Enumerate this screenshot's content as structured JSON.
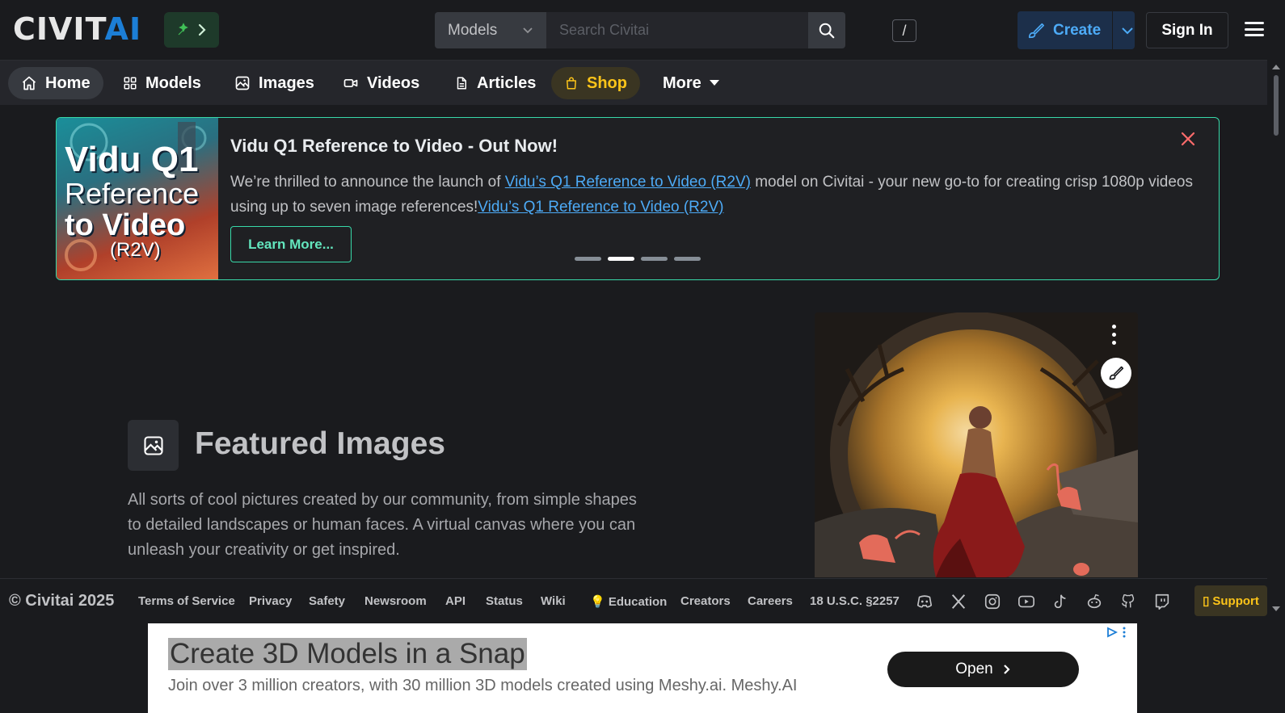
{
  "header": {
    "logo_main": "CIVIT",
    "logo_accent": "AI",
    "search_category": "Models",
    "search_placeholder": "Search Civitai",
    "search_shortcut": "/",
    "create_label": "Create",
    "signin_label": "Sign In"
  },
  "nav": {
    "items": [
      {
        "label": "Home",
        "icon": "home-icon"
      },
      {
        "label": "Models",
        "icon": "grid-icon"
      },
      {
        "label": "Images",
        "icon": "photo-icon"
      },
      {
        "label": "Videos",
        "icon": "video-icon"
      },
      {
        "label": "Articles",
        "icon": "file-text-icon"
      },
      {
        "label": "Shop",
        "icon": "shopping-bag-icon"
      },
      {
        "label": "More",
        "icon": "caret-down-icon"
      }
    ]
  },
  "announcement": {
    "thumb_line1": "Vidu Q1",
    "thumb_line2": "Reference",
    "thumb_line3": "to Video",
    "thumb_line4": "(R2V)",
    "title": "Vidu Q1 Reference to Video - Out Now!",
    "body_part1": "We’re thrilled to announce the launch of ",
    "link1": "Vidu’s Q1 Reference to Video (R2V)",
    "body_part2": " model on Civitai - your new go-to for creating crisp 1080p videos using up to seven image references!",
    "link2": "Vidu’s Q1 Reference to Video (R2V)",
    "button_label": "Learn More...",
    "slide_count": 4,
    "active_slide": 2
  },
  "featured": {
    "title": "Featured Images",
    "description": "All sorts of cool pictures created by our community, from simple shapes to detailed landscapes or human faces. A virtual canvas where you can unleash your creativity or get inspired."
  },
  "footer": {
    "copyright": "© Civitai 2025",
    "links": [
      "Terms of Service",
      "Privacy",
      "Safety",
      "Newsroom",
      "API",
      "Status",
      "Wiki",
      "💡 Education",
      "Creators",
      "Careers",
      "18 U.S.C. §2257"
    ],
    "social_icons": [
      "discord-icon",
      "x-icon",
      "instagram-icon",
      "youtube-icon",
      "tiktok-icon",
      "reddit-icon",
      "github-icon",
      "twitch-icon"
    ],
    "support_label": "Support"
  },
  "ad": {
    "title": "Create 3D Models in a Snap",
    "subtitle": "Join over 3 million creators, with 30 million 3D models created using Meshy.ai. Meshy.AI",
    "button_label": "Open"
  },
  "colors": {
    "accent_blue": "#4dabf7",
    "accent_teal": "#38d9a9",
    "shop_yellow": "#fcc419",
    "background": "#1a1b1e"
  }
}
